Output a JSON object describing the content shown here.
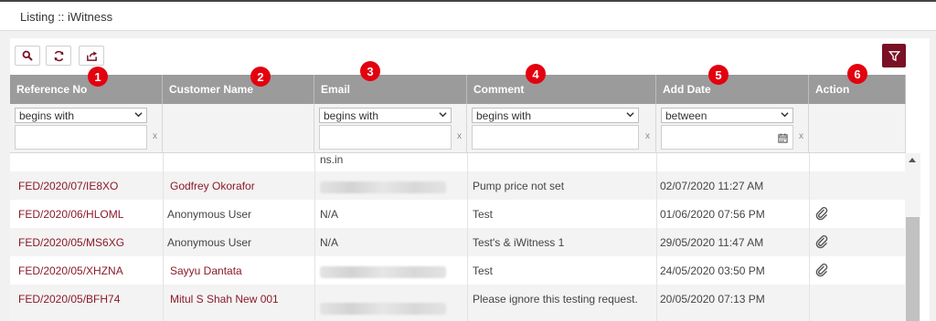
{
  "window": {
    "title": "Listing :: iWitness"
  },
  "toolbar": {
    "search_icon": "search-icon",
    "refresh_icon": "refresh-icon",
    "export_icon": "export-icon",
    "filter_icon": "filter-icon"
  },
  "columns": [
    {
      "label": "Reference No",
      "badge": "1"
    },
    {
      "label": "Customer Name",
      "badge": "2"
    },
    {
      "label": "Email",
      "badge": "3"
    },
    {
      "label": "Comment",
      "badge": "4"
    },
    {
      "label": "Add Date",
      "badge": "5"
    },
    {
      "label": "Action",
      "badge": "6"
    }
  ],
  "filters": {
    "reference": {
      "operator": "begins with",
      "value": "",
      "clear": "x"
    },
    "email": {
      "operator": "begins with",
      "value": "",
      "clear": "x"
    },
    "comment": {
      "operator": "begins with",
      "value": "",
      "clear": "x"
    },
    "add_date": {
      "operator": "between",
      "value": "",
      "clear": "x"
    }
  },
  "partial_row": {
    "email": "ns.in"
  },
  "rows": [
    {
      "ref": "FED/2020/07/IE8XO",
      "customer": "Godfrey Okorafor",
      "email": "",
      "comment": "Pump price not set",
      "date": "02/07/2020 11:27 AM",
      "attachment": false
    },
    {
      "ref": "FED/2020/06/HLOML",
      "customer": "Anonymous User",
      "email": "N/A",
      "comment": "Test",
      "date": "01/06/2020 07:56 PM",
      "attachment": true
    },
    {
      "ref": "FED/2020/05/MS6XG",
      "customer": "Anonymous User",
      "email": "N/A",
      "comment": "Test's & iWitness 1",
      "date": "29/05/2020 11:47 AM",
      "attachment": true
    },
    {
      "ref": "FED/2020/05/XHZNA",
      "customer": "Sayyu Dantata",
      "email": "",
      "comment": "Test",
      "date": "24/05/2020 03:50 PM",
      "attachment": true
    },
    {
      "ref": "FED/2020/05/BFH74",
      "customer": "Mitul S Shah New 001",
      "email": "",
      "comment": "Please ignore this testing request.",
      "date": "20/05/2020 07:13 PM",
      "attachment": false
    }
  ],
  "colors": {
    "accent": "#7a1023",
    "header_bg": "#9b9b9b",
    "badge": "#e3000f",
    "link": "#8a1a2a"
  }
}
